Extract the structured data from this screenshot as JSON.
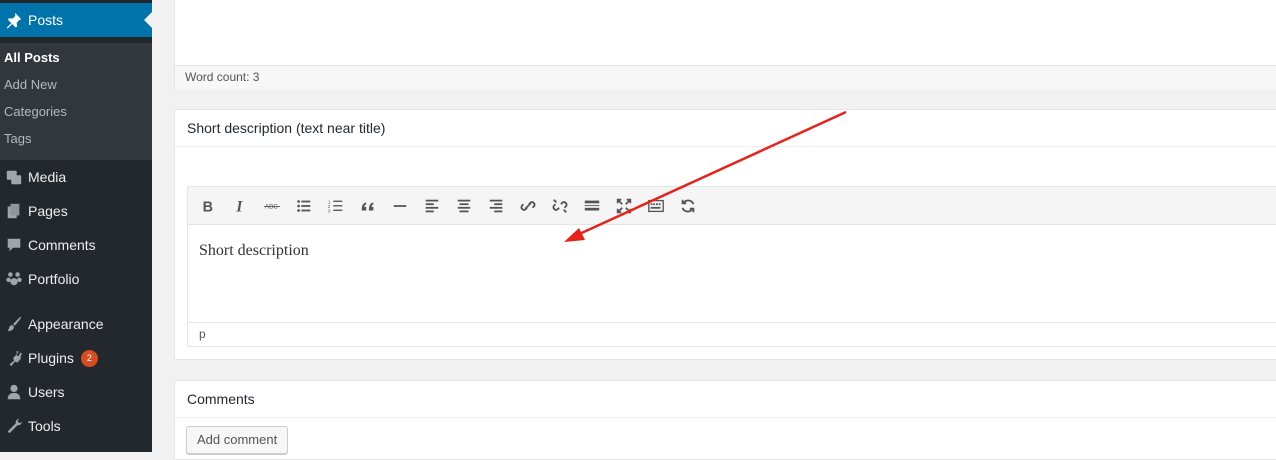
{
  "sidebar": {
    "posts": {
      "label": "Posts",
      "icon": "pushpin-icon"
    },
    "submenu": [
      {
        "label": "All Posts",
        "current": true
      },
      {
        "label": "Add New"
      },
      {
        "label": "Categories"
      },
      {
        "label": "Tags"
      }
    ],
    "items": [
      {
        "label": "Media",
        "icon": "media-icon"
      },
      {
        "label": "Pages",
        "icon": "pages-icon"
      },
      {
        "label": "Comments",
        "icon": "comment-bubble-icon"
      },
      {
        "label": "Portfolio",
        "icon": "portfolio-icon"
      },
      {
        "label": "Appearance",
        "icon": "paintbrush-icon"
      },
      {
        "label": "Plugins",
        "icon": "plugin-icon",
        "badge": "2"
      },
      {
        "label": "Users",
        "icon": "user-icon"
      },
      {
        "label": "Tools",
        "icon": "wrench-icon"
      }
    ],
    "colors": {
      "bg": "#23282d",
      "active": "#0073aa",
      "submenu_bg": "#32373c",
      "badge": "#d54e21"
    }
  },
  "content_editor": {
    "word_count": "Word count: 3"
  },
  "short_description": {
    "title": "Short description (text near title)",
    "toolbar": [
      "bold-icon",
      "italic-icon",
      "strikethrough-icon",
      "bulleted-list-icon",
      "numbered-list-icon",
      "blockquote-icon",
      "horizontal-line-icon",
      "align-left-icon",
      "align-center-icon",
      "align-right-icon",
      "link-icon",
      "unlink-icon",
      "read-more-icon",
      "fullscreen-icon",
      "toolbar-toggle-icon",
      "refresh-icon"
    ],
    "text": "Short description",
    "path": "p"
  },
  "comments": {
    "title": "Comments",
    "add_button": "Add comment"
  },
  "annotation": {
    "color": "#e8221b",
    "shape": "arrow"
  }
}
